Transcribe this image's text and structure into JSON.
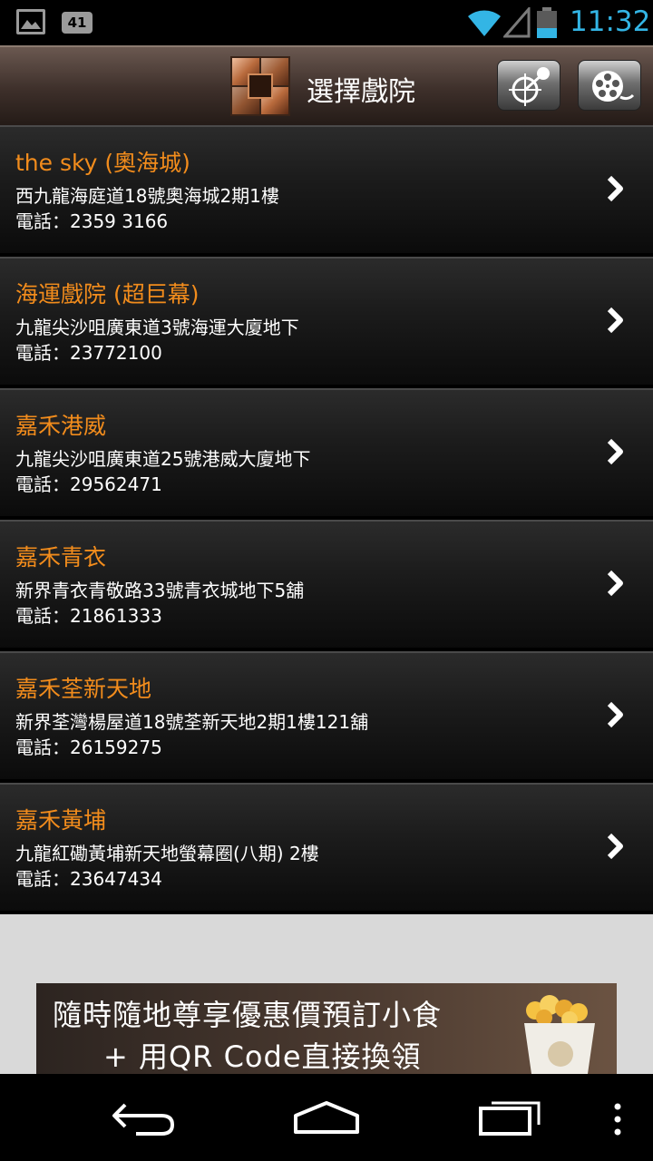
{
  "status_bar": {
    "notification_badge": "41",
    "time": "11:32"
  },
  "header": {
    "title": "選擇戲院",
    "map_button_icon": "map-pin-icon",
    "film_button_icon": "film-reel-icon"
  },
  "cinemas": [
    {
      "name": "the sky (奧海城)",
      "address": "西九龍海庭道18號奧海城2期1樓",
      "phone": "電話：2359 3166"
    },
    {
      "name": "海運戲院 (超巨幕)",
      "address": "九龍尖沙咀廣東道3號海運大廈地下",
      "phone": "電話：23772100"
    },
    {
      "name": "嘉禾港威",
      "address": "九龍尖沙咀廣東道25號港威大廈地下",
      "phone": "電話：29562471"
    },
    {
      "name": "嘉禾青衣",
      "address": "新界青衣青敬路33號青衣城地下5舖",
      "phone": "電話：21861333"
    },
    {
      "name": "嘉禾荃新天地",
      "address": "新界荃灣楊屋道18號荃新天地2期1樓121舖",
      "phone": "電話：26159275"
    },
    {
      "name": "嘉禾黃埔",
      "address": "九龍紅磡黃埔新天地螢幕圈(八期) 2樓",
      "phone": "電話：23647434"
    }
  ],
  "banner": {
    "line1": "隨時隨地尊享優惠價預訂小食",
    "line2": "+ 用QR Code直接換領"
  },
  "colors": {
    "accent_orange": "#f28c1c",
    "status_blue": "#33b5e5"
  }
}
